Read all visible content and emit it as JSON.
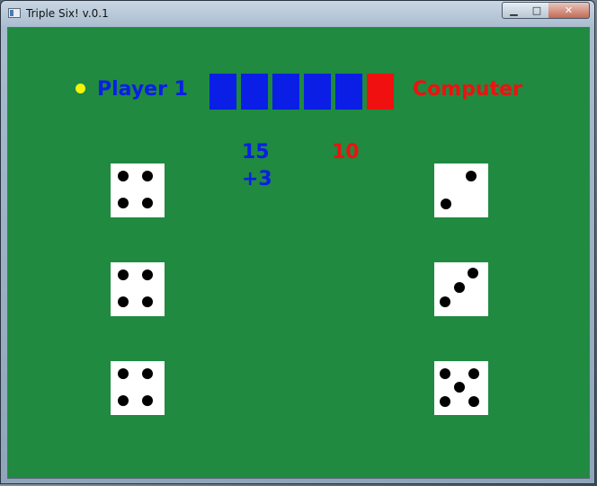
{
  "window": {
    "title": "Triple Six! v.0.1",
    "controls": {
      "minimize": "▁",
      "maximize": "□",
      "close": "✕"
    }
  },
  "colors": {
    "table": "#1f8a40",
    "player": "#0a1ee6",
    "computer": "#f01010",
    "turn_indicator": "#f4f40a"
  },
  "players": {
    "player_name": "Player 1",
    "computer_name": "Computer"
  },
  "tracker": {
    "blocks": [
      "player",
      "player",
      "player",
      "player",
      "player",
      "computer"
    ]
  },
  "scores": {
    "player_score": "15",
    "player_bonus": "+3",
    "computer_score": "10"
  },
  "dice": {
    "player": [
      4,
      4,
      4
    ],
    "computer": [
      2,
      3,
      5
    ]
  },
  "icons": {
    "app": "app-window-icon",
    "turn": "turn-indicator-dot"
  }
}
